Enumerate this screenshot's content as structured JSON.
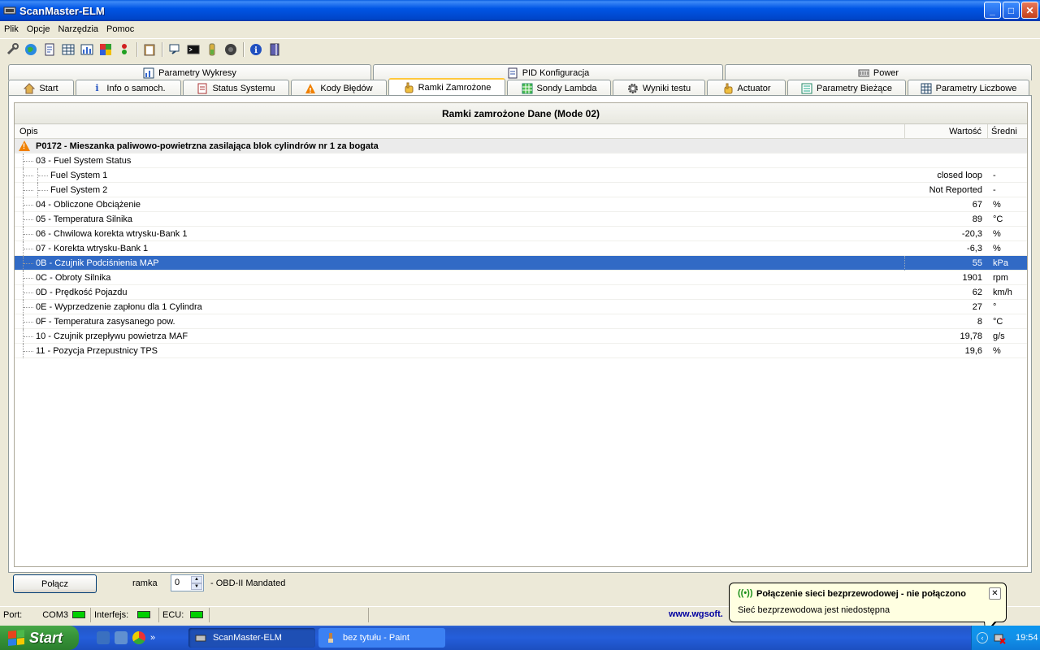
{
  "window": {
    "title": "ScanMaster-ELM",
    "btn_min": "_",
    "btn_max": "□",
    "btn_close": "✕"
  },
  "menu": [
    "Plik",
    "Opcje",
    "Narzędzia",
    "Pomoc"
  ],
  "toolbar_icons": [
    "wrench-icon",
    "globe-icon",
    "document-icon",
    "table-icon",
    "chart-icon",
    "map-icon",
    "traffic-light-icon",
    "clipboard-icon",
    "magnifier-icon",
    "terminal-icon",
    "battery-icon",
    "record-icon",
    "info-icon",
    "book-icon"
  ],
  "tabs_top": [
    "Parametry Wykresy",
    "PID Konfiguracja",
    "Power"
  ],
  "tabs_bottom": [
    "Start",
    "Info o samoch.",
    "Status Systemu",
    "Kody Błędów",
    "Ramki Zamrożone",
    "Sondy Lambda",
    "Wyniki testu",
    "Actuator",
    "Parametry Bieżące",
    "Parametry Liczbowe"
  ],
  "active_tab": "Ramki Zamrożone",
  "grid": {
    "title": "Ramki zamrożone Dane (Mode 02)",
    "col_opis": "Opis",
    "col_wartosc": "Wartość",
    "col_sredni": "Średni",
    "group_label": "P0172 - Mieszanka paliwowo-powietrzna zasilająca blok cylindrów nr 1 za bogata",
    "rows": [
      {
        "label": "03 - Fuel System Status",
        "value": "",
        "unit": "",
        "level": 1
      },
      {
        "label": "Fuel System 1",
        "value": "closed loop",
        "unit": "-",
        "level": 2
      },
      {
        "label": "Fuel System 2",
        "value": "Not Reported",
        "unit": "-",
        "level": 2
      },
      {
        "label": "04 - Obliczone Obciążenie",
        "value": "67",
        "unit": "%",
        "level": 1
      },
      {
        "label": "05 - Temperatura Silnika",
        "value": "89",
        "unit": "°C",
        "level": 1
      },
      {
        "label": "06 - Chwilowa korekta wtrysku-Bank 1",
        "value": "-20,3",
        "unit": "%",
        "level": 1
      },
      {
        "label": "07 - Korekta wtrysku-Bank 1",
        "value": "-6,3",
        "unit": "%",
        "level": 1
      },
      {
        "label": "0B - Czujnik Podciśnienia MAP",
        "value": "55",
        "unit": "kPa",
        "level": 1,
        "selected": true
      },
      {
        "label": "0C - Obroty Silnika",
        "value": "1901",
        "unit": "rpm",
        "level": 1
      },
      {
        "label": "0D - Prędkość Pojazdu",
        "value": "62",
        "unit": "km/h",
        "level": 1
      },
      {
        "label": "0E - Wyprzedzenie zapłonu dla 1 Cylindra",
        "value": "27",
        "unit": "°",
        "level": 1
      },
      {
        "label": "0F - Temperatura zasysanego pow.",
        "value": "8",
        "unit": "°C",
        "level": 1
      },
      {
        "label": "10 - Czujnik przepływu powietrza MAF",
        "value": "19,78",
        "unit": "g/s",
        "level": 1
      },
      {
        "label": "11 - Pozycja Przepustnicy TPS",
        "value": "19,6",
        "unit": "%",
        "level": 1
      }
    ]
  },
  "controls": {
    "connect_label": "Połącz",
    "ramka_label": "ramka",
    "ramka_value": "0",
    "mode_label": "- OBD-II Mandated"
  },
  "statusbar": {
    "port_label": "Port:",
    "port_value": "COM3",
    "interface_label": "Interfejs:",
    "ecu_label": "ECU:",
    "url": "www.wgsoft."
  },
  "balloon": {
    "title": "Połączenie sieci bezprzewodowej - nie połączono",
    "text": "Sieć bezprzewodowa jest niedostępna",
    "close": "✕"
  },
  "taskbar": {
    "start_label": "Start",
    "tasks": [
      "ScanMaster-ELM",
      "bez tytułu - Paint"
    ],
    "clock": "19:54",
    "more": "»"
  }
}
